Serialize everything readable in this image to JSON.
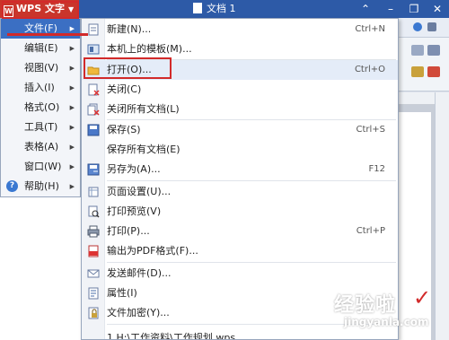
{
  "titlebar": {
    "app_button": "WPS 文字",
    "doc_title": "文档 1",
    "colors": {
      "titlebar": "#2d5aa7",
      "app_button": "#c9352b"
    }
  },
  "left_menu": {
    "items": [
      {
        "label": "文件(F)",
        "icon": "none"
      },
      {
        "label": "编辑(E)",
        "icon": "none"
      },
      {
        "label": "视图(V)",
        "icon": "none"
      },
      {
        "label": "插入(I)",
        "icon": "none"
      },
      {
        "label": "格式(O)",
        "icon": "none"
      },
      {
        "label": "工具(T)",
        "icon": "none"
      },
      {
        "label": "表格(A)",
        "icon": "none"
      },
      {
        "label": "窗口(W)",
        "icon": "none"
      },
      {
        "label": "帮助(H)",
        "icon": "help-icon"
      }
    ]
  },
  "file_menu": {
    "items": [
      {
        "label": "新建(N)...",
        "shortcut": "Ctrl+N",
        "icon": "new-doc-icon"
      },
      {
        "label": "本机上的模板(M)...",
        "shortcut": "",
        "icon": "template-icon"
      },
      {
        "label": "打开(O)...",
        "shortcut": "Ctrl+O",
        "icon": "open-folder-icon"
      },
      {
        "label": "关闭(C)",
        "shortcut": "",
        "icon": "close-doc-icon"
      },
      {
        "label": "关闭所有文档(L)",
        "shortcut": "",
        "icon": "close-all-icon"
      },
      {
        "label": "保存(S)",
        "shortcut": "Ctrl+S",
        "icon": "save-icon"
      },
      {
        "label": "保存所有文档(E)",
        "shortcut": "",
        "icon": "none"
      },
      {
        "label": "另存为(A)...",
        "shortcut": "F12",
        "icon": "save-as-icon"
      },
      {
        "label": "页面设置(U)...",
        "shortcut": "",
        "icon": "page-setup-icon"
      },
      {
        "label": "打印预览(V)",
        "shortcut": "",
        "icon": "print-preview-icon"
      },
      {
        "label": "打印(P)...",
        "shortcut": "Ctrl+P",
        "icon": "printer-icon"
      },
      {
        "label": "输出为PDF格式(F)...",
        "shortcut": "",
        "icon": "pdf-icon"
      },
      {
        "label": "发送邮件(D)...",
        "shortcut": "",
        "icon": "mail-icon"
      },
      {
        "label": "属性(I)",
        "shortcut": "",
        "icon": "properties-icon"
      },
      {
        "label": "文件加密(Y)...",
        "shortcut": "",
        "icon": "encrypt-icon"
      },
      {
        "label": "1 H:\\工作资料\\工作规划.wps",
        "shortcut": "",
        "icon": "none"
      }
    ]
  },
  "watermark": {
    "line1": "经验啦",
    "line2": "jingyanla.com"
  }
}
